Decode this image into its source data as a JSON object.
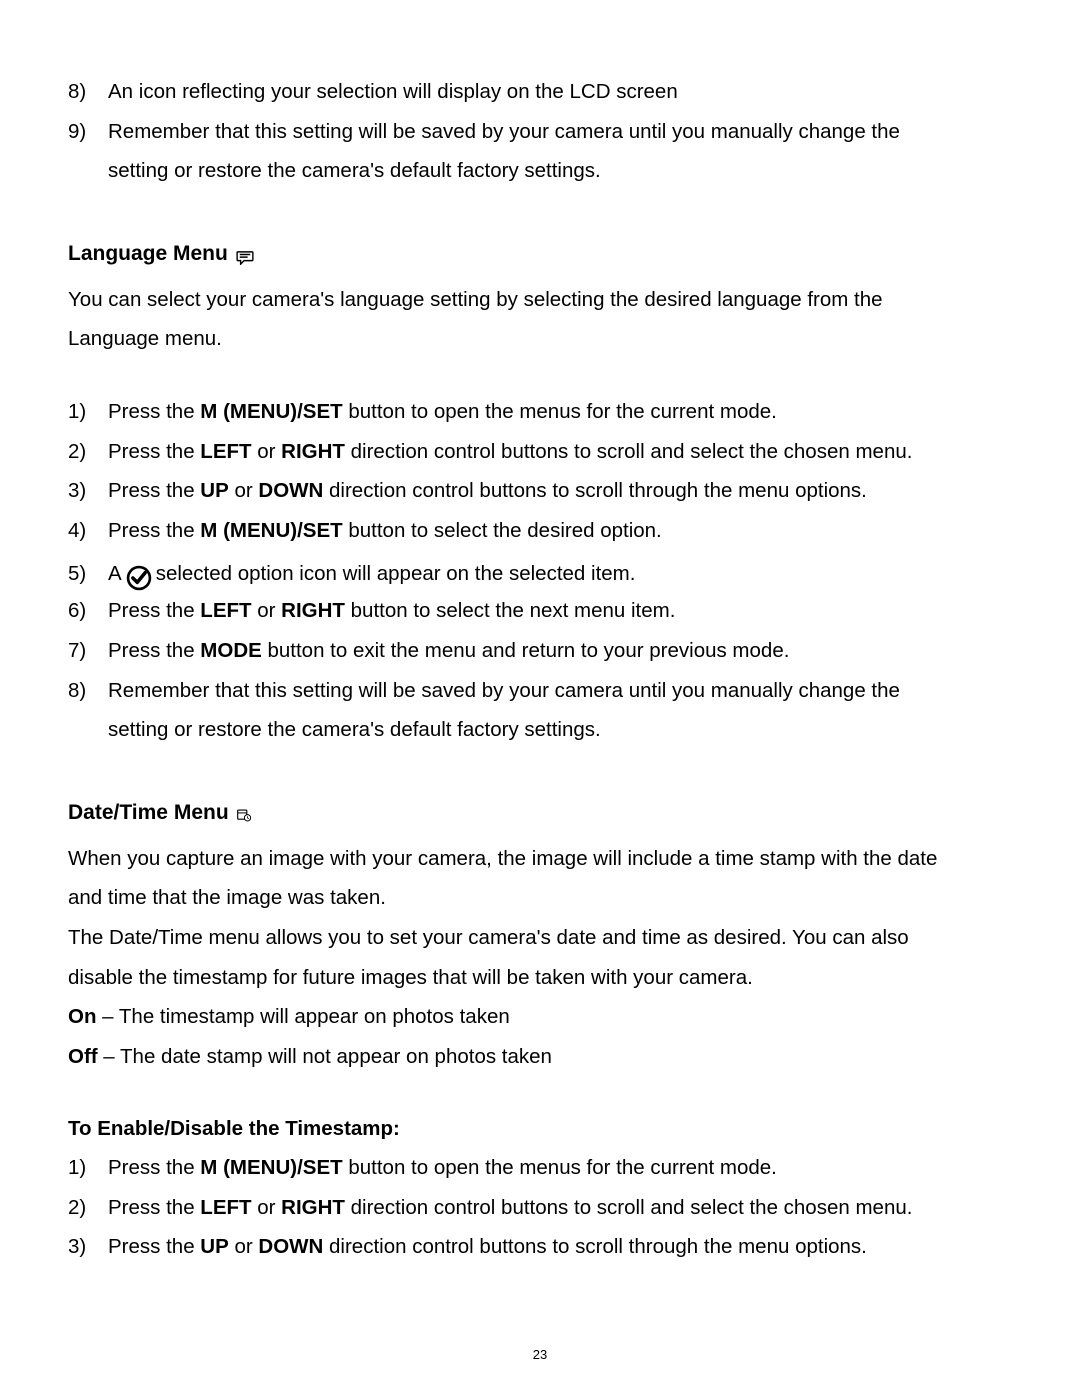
{
  "topList": {
    "item8": {
      "num": "8)",
      "text": "An icon reflecting your selection will display on the LCD screen"
    },
    "item9": {
      "num": "9)",
      "textA": "Remember that this setting will be saved by your camera until you manually change the",
      "textB": "setting or restore the camera's default factory settings."
    }
  },
  "lang": {
    "heading": "Language Menu",
    "introA": "You can select your camera's language setting by selecting the desired language from the",
    "introB": "Language menu.",
    "steps": {
      "s1": {
        "num": "1)",
        "pre": "Press the ",
        "b": "M (MENU)/SET",
        "post": " button to open the menus for the current mode."
      },
      "s2": {
        "num": "2)",
        "pre": "Press the ",
        "b1": "LEFT",
        "mid": " or ",
        "b2": "RIGHT",
        "post": " direction control buttons to scroll and select the chosen menu."
      },
      "s3": {
        "num": "3)",
        "pre": "Press the ",
        "b1": "UP",
        "mid": " or ",
        "b2": "DOWN",
        "post": " direction control buttons to scroll through the menu options."
      },
      "s4": {
        "num": "4)",
        "pre": "Press the ",
        "b": "M (MENU)/SET",
        "post": " button to select the desired option."
      },
      "s5": {
        "num": "5)",
        "pre": "A  ",
        "post": "selected option icon will appear on the selected item."
      },
      "s6": {
        "num": "6)",
        "pre": "Press the ",
        "b1": "LEFT",
        "mid": " or ",
        "b2": "RIGHT",
        "post": " button to select the next menu item."
      },
      "s7": {
        "num": "7)",
        "pre": "Press the ",
        "b": "MODE",
        "post": " button to exit the menu and return to your previous mode."
      },
      "s8": {
        "num": "8)",
        "textA": "Remember that this setting will be saved by your camera until you manually change the",
        "textB": "setting or restore the camera's default factory settings."
      }
    }
  },
  "dt": {
    "heading": "Date/Time Menu",
    "p1a": "When you capture an image with your camera, the image will include a time stamp with the date",
    "p1b": "and time that the image was taken.",
    "p2a": "The Date/Time menu allows you to set your camera's date and time as desired. You can also",
    "p2b": "disable the timestamp for future images that will be taken with your camera.",
    "onLabel": "On",
    "onText": " – The timestamp will appear on photos taken",
    "offLabel": "Off",
    "offText": " – The date stamp will not appear on photos taken",
    "sub": "To Enable/Disable the Timestamp:",
    "steps": {
      "s1": {
        "num": "1)",
        "pre": "Press the ",
        "b": "M (MENU)/SET",
        "post": " button to open the menus for the current mode."
      },
      "s2": {
        "num": "2)",
        "pre": "Press the ",
        "b1": "LEFT",
        "mid": " or ",
        "b2": "RIGHT",
        "post": " direction control buttons to scroll and select the chosen menu."
      },
      "s3": {
        "num": "3)",
        "pre": "Press the ",
        "b1": "UP",
        "mid": " or ",
        "b2": "DOWN",
        "post": " direction control buttons to scroll through the menu options."
      }
    }
  },
  "pageNumber": "23"
}
